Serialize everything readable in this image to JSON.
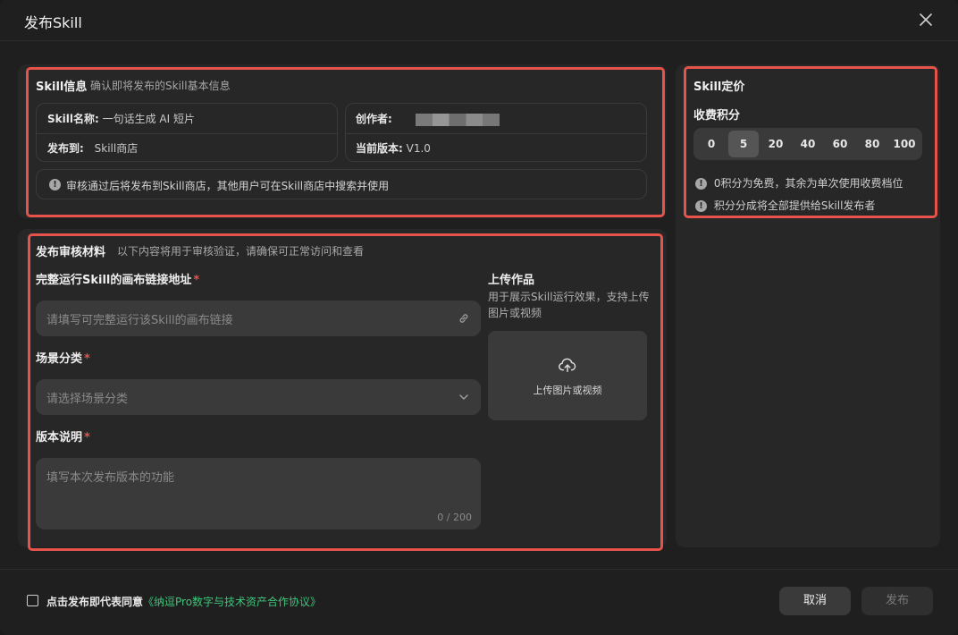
{
  "dialog": {
    "title": "发布Skill"
  },
  "skill_info": {
    "title": "Skill信息",
    "subtitle": "确认即将发布的Skill基本信息",
    "name_label": "Skill名称:",
    "name_value": "一句话生成 AI 短片",
    "creator_label": "创作者:",
    "publish_to_label": "发布到:",
    "publish_to_value": "Skill商店",
    "version_label": "当前版本:",
    "version_value": "V1.0",
    "notice": "审核通过后将发布到Skill商店，其他用户可在Skill商店中搜索并使用"
  },
  "review": {
    "title": "发布审核材料",
    "subtitle": "以下内容将用于审核验证，请确保可正常访问和查看",
    "link_label": "完整运行Skill的画布链接地址",
    "link_placeholder": "请填写可完整运行该Skill的画布链接",
    "scene_label": "场景分类",
    "scene_placeholder": "请选择场景分类",
    "version_desc_label": "版本说明",
    "version_desc_placeholder": "填写本次发布版本的功能",
    "char_count": "0 / 200",
    "upload_title": "上传作品",
    "upload_desc_line1": "用于展示Skill运行效果，支持上传",
    "upload_desc_line2": "图片或视频",
    "upload_button": "上传图片或视频",
    "required_mark": "*"
  },
  "pricing": {
    "title": "Skill定价",
    "points_label": "收费积分",
    "options": [
      "0",
      "5",
      "20",
      "40",
      "60",
      "80",
      "100"
    ],
    "selected": "5",
    "tip1": "0积分为免费，其余为单次使用收费档位",
    "tip2": "积分分成将全部提供给Skill发布者"
  },
  "footer": {
    "agree_text": "点击发布即代表同意",
    "agree_link": "《纳逗Pro数字与技术资产合作协议》",
    "cancel": "取消",
    "publish": "发布"
  },
  "icons": {
    "alert": "!",
    "alert_icon": "alert-circle-icon",
    "close_icon": "close-icon",
    "link_icon": "link-icon",
    "chevron_icon": "chevron-down-icon",
    "upload_icon": "cloud-upload-icon"
  },
  "colors": {
    "highlight": "#e5534b",
    "link": "#3fc47a",
    "background": "#1f1f1f",
    "panel": "#272727"
  }
}
